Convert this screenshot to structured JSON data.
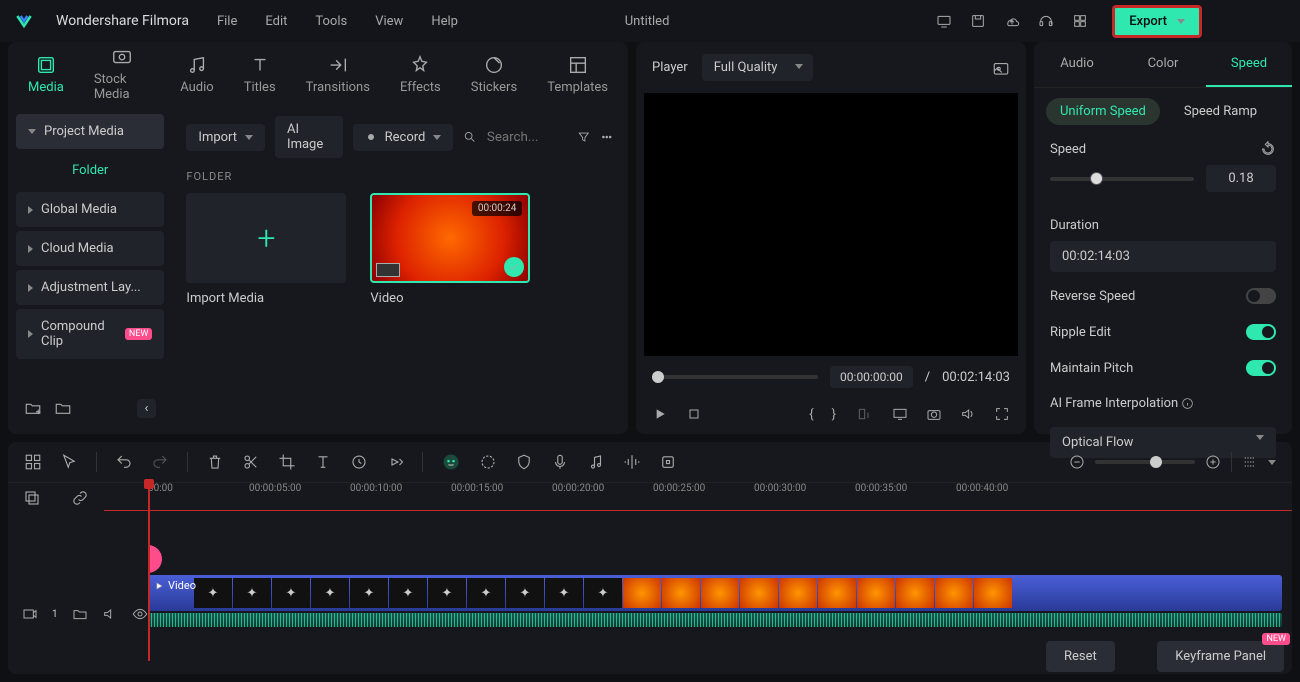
{
  "app": {
    "name": "Wondershare Filmora",
    "title": "Untitled"
  },
  "menu": [
    "File",
    "Edit",
    "Tools",
    "View",
    "Help"
  ],
  "export_label": "Export",
  "media_tabs": [
    {
      "label": "Media",
      "icon": "media"
    },
    {
      "label": "Stock Media",
      "icon": "stock"
    },
    {
      "label": "Audio",
      "icon": "audio"
    },
    {
      "label": "Titles",
      "icon": "titles"
    },
    {
      "label": "Transitions",
      "icon": "transitions"
    },
    {
      "label": "Effects",
      "icon": "effects"
    },
    {
      "label": "Stickers",
      "icon": "stickers"
    },
    {
      "label": "Templates",
      "icon": "templates"
    }
  ],
  "sidebar": {
    "head": "Project Media",
    "folder": "Folder",
    "items": [
      "Global Media",
      "Cloud Media",
      "Adjustment Lay...",
      "Compound Clip"
    ]
  },
  "content_toolbar": {
    "import": "Import",
    "ai": "AI Image",
    "record": "Record",
    "search_ph": "Search..."
  },
  "folder_label": "FOLDER",
  "cards": {
    "import": "Import Media",
    "video": {
      "label": "Video",
      "duration": "00:00:24"
    }
  },
  "preview": {
    "player": "Player",
    "quality": "Full Quality",
    "time_current": "00:00:00:00",
    "time_sep": "/",
    "time_total": "00:02:14:03"
  },
  "right": {
    "tabs": [
      "Audio",
      "Color",
      "Speed"
    ],
    "subtabs": [
      "Uniform Speed",
      "Speed Ramp"
    ],
    "speed_label": "Speed",
    "speed_value": "0.18",
    "duration_label": "Duration",
    "duration_value": "00:02:14:03",
    "reverse": "Reverse Speed",
    "ripple": "Ripple Edit",
    "pitch": "Maintain Pitch",
    "ai_interp": "AI Frame Interpolation",
    "ai_value": "Optical Flow",
    "reset": "Reset",
    "keyframe": "Keyframe Panel",
    "new": "NEW"
  },
  "timeline": {
    "marks": [
      "00:00",
      "00:00:05:00",
      "00:00:10:00",
      "00:00:15:00",
      "00:00:20:00",
      "00:00:25:00",
      "00:00:30:00",
      "00:00:35:00",
      "00:00:40:00"
    ],
    "clip_label": "Video",
    "track_num": "1"
  }
}
